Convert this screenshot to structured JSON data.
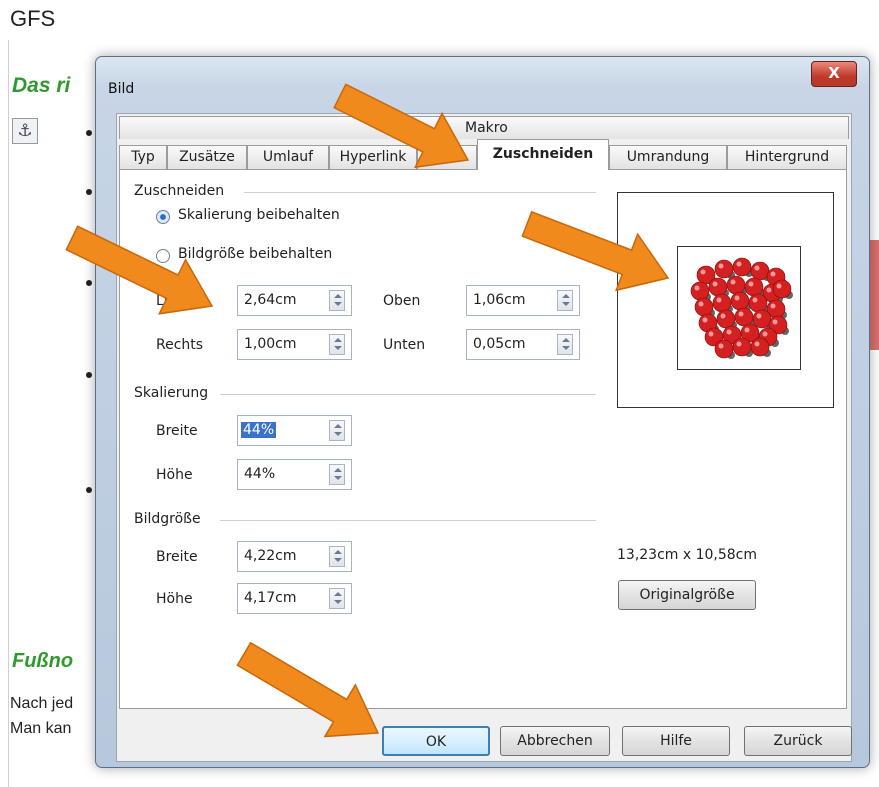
{
  "document": {
    "title": "GFS",
    "heading1": "Das ri",
    "heading2": "Fußno",
    "line1": "Nach jed",
    "line2": "Man kan",
    "anchor_icon": "anchor-icon"
  },
  "dialog": {
    "title": "Bild",
    "close_label": "X",
    "tab_macro": "Makro",
    "tabs": [
      "Typ",
      "Zusätze",
      "Umlauf",
      "Hyperlink",
      "Bild",
      "Zuschneiden",
      "Umrandung",
      "Hintergrund"
    ],
    "active_tab": "Zuschneiden",
    "crop": {
      "section": "Zuschneiden",
      "keep_scale": "Skalierung beibehalten",
      "keep_size": "Bildgröße beibehalten",
      "left_label": "Links",
      "left_value": "2,64cm",
      "top_label": "Oben",
      "top_value": "1,06cm",
      "right_label": "Rechts",
      "right_value": "1,00cm",
      "bottom_label": "Unten",
      "bottom_value": "0,05cm"
    },
    "scale": {
      "section": "Skalierung",
      "width_label": "Breite",
      "width_value": "44%",
      "height_label": "Höhe",
      "height_value": "44%"
    },
    "image_size": {
      "section": "Bildgröße",
      "width_label": "Breite",
      "width_value": "4,22cm",
      "height_label": "Höhe",
      "height_value": "4,17cm",
      "original_dims": "13,23cm x 10,58cm",
      "original_button": "Originalgröße"
    },
    "buttons": {
      "ok": "OK",
      "cancel": "Abbrechen",
      "help": "Hilfe",
      "back": "Zurück"
    }
  },
  "colors": {
    "arrow": "#f08a1c",
    "heading_green": "#2e9a2e",
    "atom_red": "#d42020",
    "atom_gray": "#666666"
  }
}
